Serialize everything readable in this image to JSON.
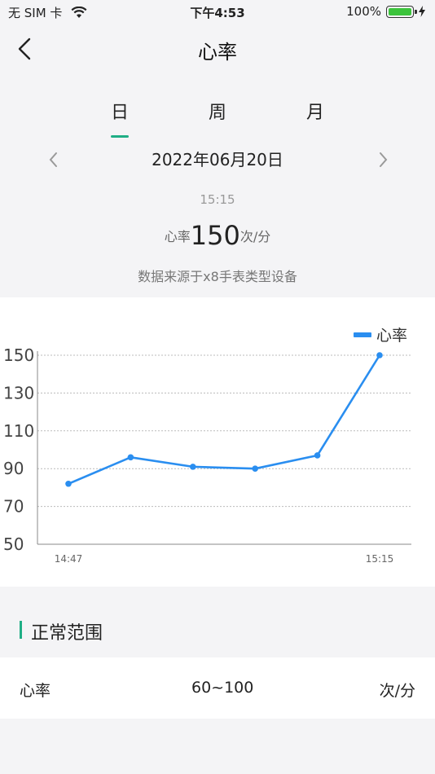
{
  "status_bar": {
    "carrier": "无 SIM 卡",
    "time": "下午4:53",
    "battery": "100%",
    "battery_color": "#3cc43c"
  },
  "nav": {
    "title": "心率"
  },
  "tabs": [
    {
      "label": "日",
      "active": true
    },
    {
      "label": "周",
      "active": false
    },
    {
      "label": "月",
      "active": false
    }
  ],
  "date": "2022年06月20日",
  "time": "15:15",
  "heart_rate": {
    "prefix": "心率",
    "value": "150",
    "unit": "次/分"
  },
  "source": "数据来源于x8手表类型设备",
  "accent_color": "#1fae85",
  "chart_data": {
    "type": "line",
    "legend": "心率",
    "legend_position": "top-right",
    "color": "#2a8ef0",
    "ylim": [
      50,
      150
    ],
    "yticks": [
      50,
      70,
      90,
      110,
      130,
      150
    ],
    "x_tick_labels": [
      "14:47",
      "15:15"
    ],
    "values": [
      82,
      96,
      91,
      90,
      97,
      150
    ],
    "grid": true
  },
  "normal_range": {
    "title": "正常范围",
    "label": "心率",
    "value": "60~100",
    "unit": "次/分"
  }
}
